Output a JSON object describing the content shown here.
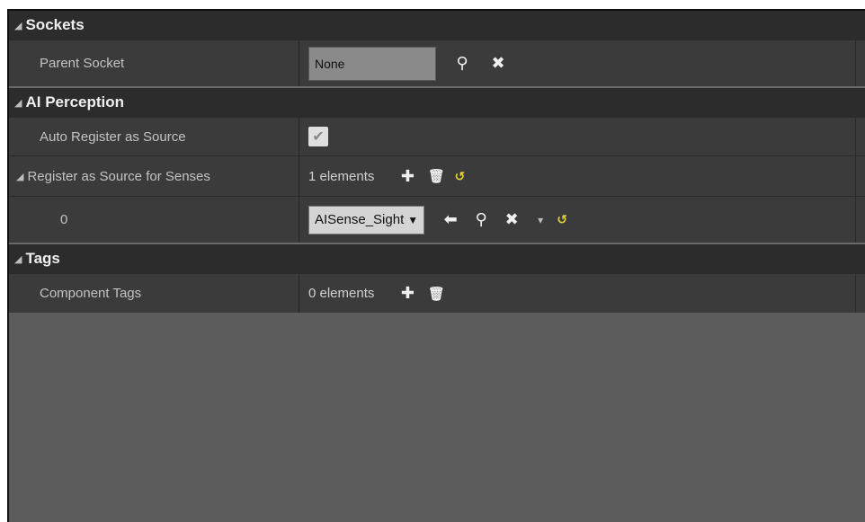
{
  "sections": {
    "sockets": {
      "title": "Sockets",
      "parent_socket": {
        "label": "Parent Socket",
        "value": "None"
      }
    },
    "ai_perception": {
      "title": "AI Perception",
      "auto_register": {
        "label": "Auto Register as Source",
        "checked": true
      },
      "register_senses": {
        "label": "Register as Source for Senses",
        "count": "1 elements"
      },
      "element0": {
        "index": "0",
        "value": "AISense_Sight"
      }
    },
    "tags": {
      "title": "Tags",
      "component_tags": {
        "label": "Component Tags",
        "count": "0 elements"
      }
    }
  },
  "glyphs": {
    "collapse": "◢",
    "search": "⚲",
    "clear": "✖",
    "add": "✚",
    "delete": "🗑",
    "reset": "↺",
    "back": "⬅",
    "check": "✔",
    "caret": "▼",
    "menu_caret": "▾"
  },
  "colors": {
    "panel_bg": "#5c5c5c",
    "header_bg": "#2c2c2c",
    "row_bg": "#3b3b3b",
    "reset_yellow": "#e8d23a"
  }
}
